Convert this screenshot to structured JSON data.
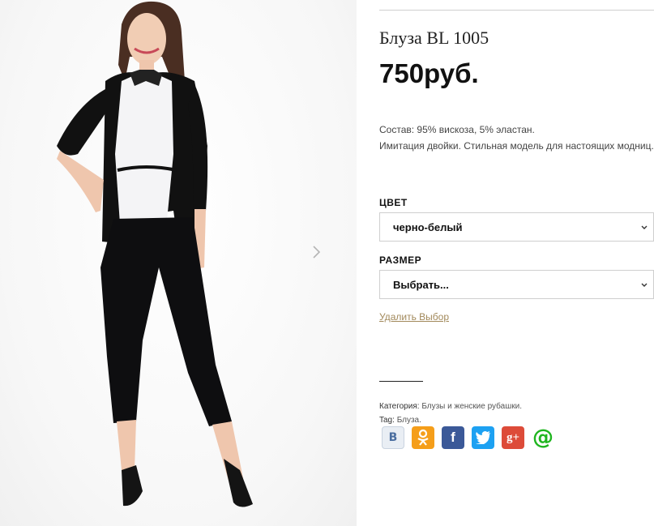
{
  "product": {
    "title": "Блуза BL 1005",
    "price": "750руб.",
    "description_line1": "Состав: 95% вискоза, 5% эластан.",
    "description_line2": "Имитация двойки. Стильная модель для настоящих модниц."
  },
  "variations": {
    "color_label": "ЦВЕТ",
    "color_value": "черно-белый",
    "size_label": "РАЗМЕР",
    "size_value": "Выбрать...",
    "reset_label": "Удалить Выбор"
  },
  "meta": {
    "category_label": "Категория:",
    "category_value": "Блузы и женские рубашки.",
    "tag_label": "Tag:",
    "tag_value": "Блуза."
  },
  "share": [
    {
      "name": "vkontakte",
      "icon": "vk-icon",
      "glyph": "B",
      "color": "#e9eef4",
      "fg": "#4a6ea0"
    },
    {
      "name": "odnoklassniki",
      "icon": "odnoklassniki-icon",
      "glyph": "",
      "color": "#f59e1a",
      "fg": "#ffffff"
    },
    {
      "name": "facebook",
      "icon": "facebook-icon",
      "glyph": "f",
      "color": "#3b5998",
      "fg": "#ffffff"
    },
    {
      "name": "twitter",
      "icon": "twitter-icon",
      "glyph": "",
      "color": "#1da1f2",
      "fg": "#ffffff"
    },
    {
      "name": "google-plus",
      "icon": "google-plus-icon",
      "glyph": "g+",
      "color": "#dd4b39",
      "fg": "#ffffff"
    },
    {
      "name": "mail-ru",
      "icon": "mail-ru-icon",
      "glyph": "@",
      "color": "#ffffff",
      "fg": "#1fb51f"
    }
  ],
  "colors": {
    "reset_link": "#a2895b",
    "text_dark": "#111111"
  }
}
